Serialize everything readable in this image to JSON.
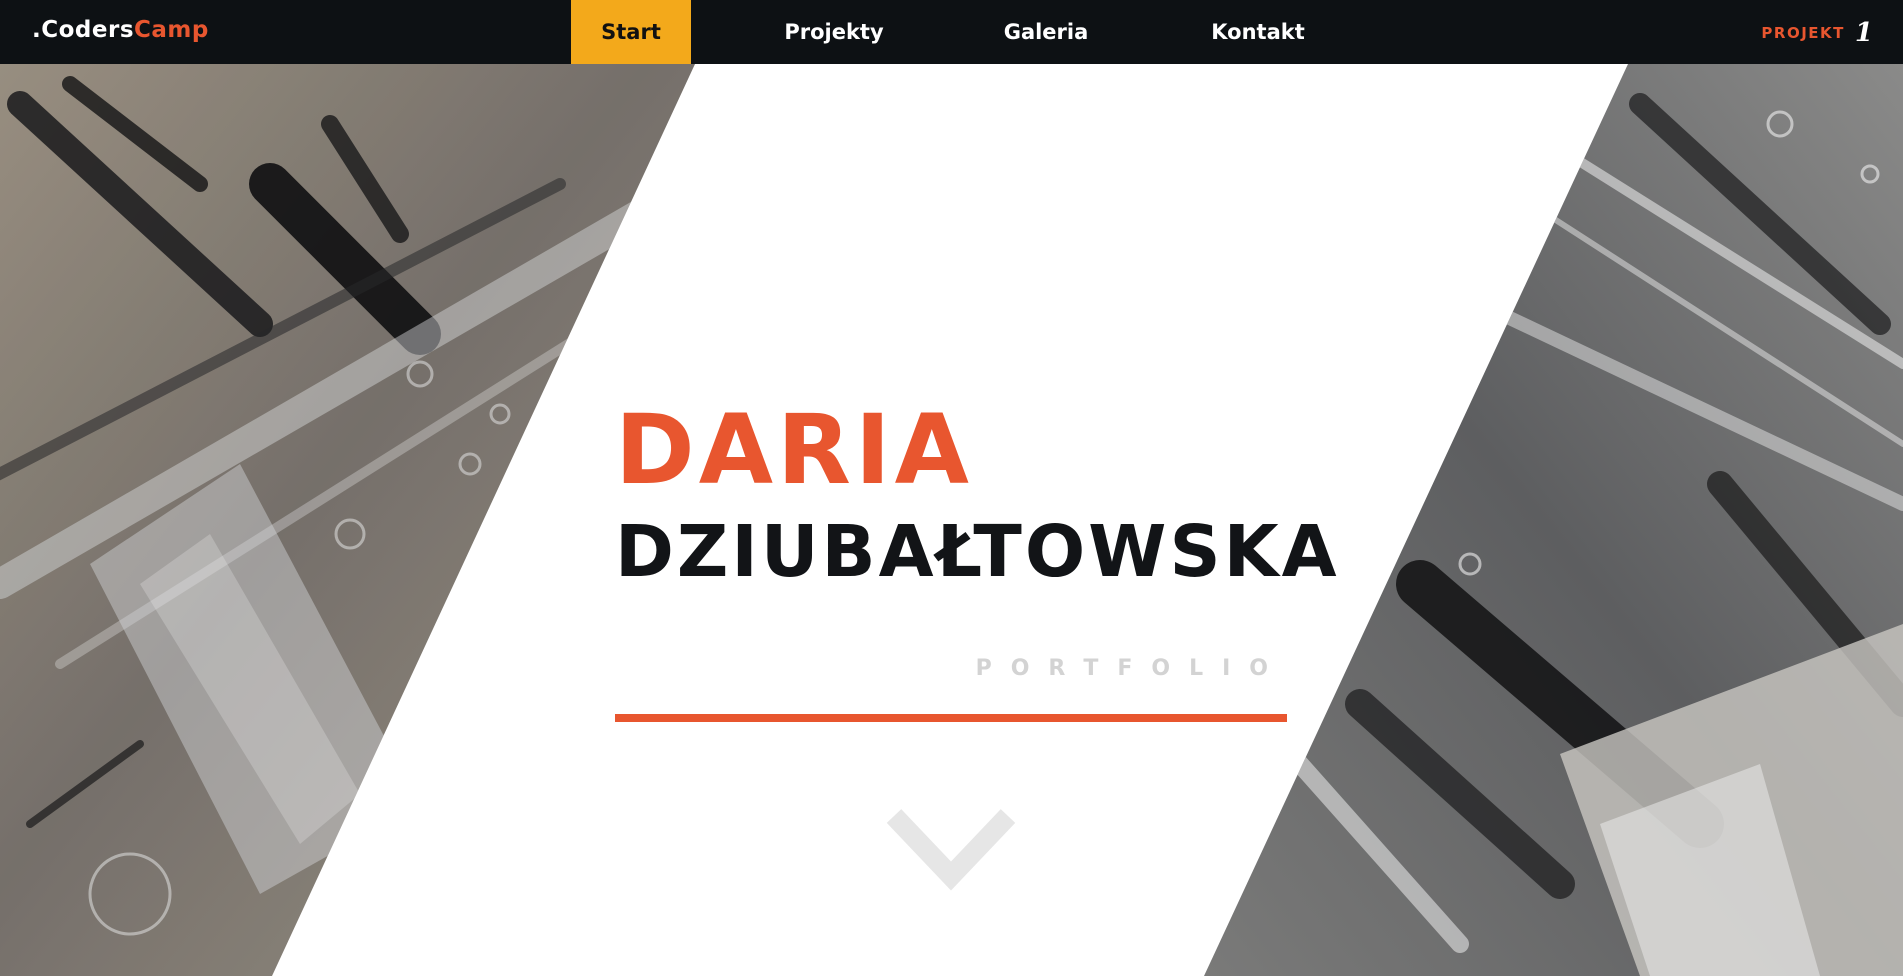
{
  "navbar": {
    "logo_prefix": ".Coders",
    "logo_accent": "Camp",
    "links": [
      {
        "label": "Start",
        "active": true
      },
      {
        "label": "Projekty",
        "active": false
      },
      {
        "label": "Galeria",
        "active": false
      },
      {
        "label": "Kontakt",
        "active": false
      }
    ],
    "badge_label": "PROJEKT",
    "badge_number": "1"
  },
  "hero": {
    "first_name": "DARIA",
    "last_name": "DZIUBAŁTOWSKA",
    "subtitle": "PORTFOLIO",
    "scroll_icon": "chevron-down-icon"
  },
  "colors": {
    "navbar_bg": "#0d1114",
    "accent_orange": "#e8562f",
    "active_tab": "#f3a91b",
    "dark_text": "#121417",
    "muted_grey": "#d3d3d3"
  }
}
